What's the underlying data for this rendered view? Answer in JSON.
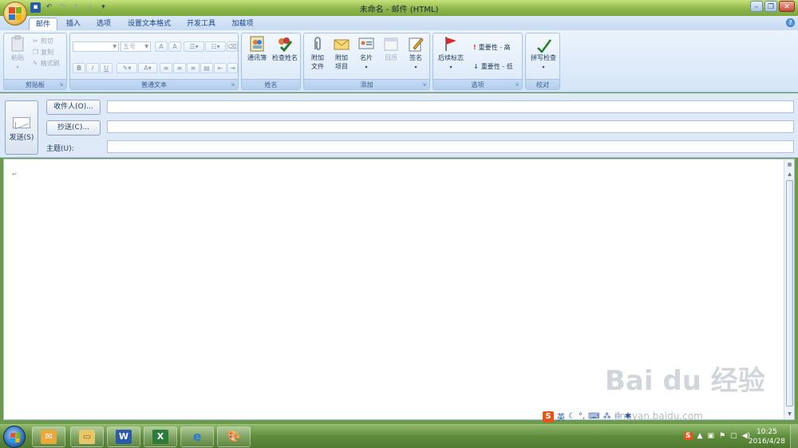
{
  "window": {
    "title": "未命名 - 邮件 (HTML)"
  },
  "qat": [
    "save-icon",
    "undo-icon",
    "redo-icon",
    "up-arrow-icon",
    "down-arrow-icon",
    "customize-icon"
  ],
  "tabs": [
    {
      "label": "邮件",
      "active": true
    },
    {
      "label": "插入"
    },
    {
      "label": "选项"
    },
    {
      "label": "设置文本格式"
    },
    {
      "label": "开发工具"
    },
    {
      "label": "加载项"
    }
  ],
  "groups": {
    "clipboard": {
      "label": "剪贴板",
      "paste": "粘贴",
      "cut": "剪切",
      "copy": "复制",
      "format_painter": "格式刷"
    },
    "basic_text": {
      "label": "普通文本",
      "font_size": "五号",
      "bold": "B",
      "italic": "I",
      "underline": "U",
      "grow": "A",
      "shrink": "A",
      "font_color": "A"
    },
    "names": {
      "label": "姓名",
      "address_book": "通讯簿",
      "check_names": "检查姓名"
    },
    "include": {
      "label": "添加",
      "attach_file_1": "附加",
      "attach_file_2": "文件",
      "attach_item_1": "附加",
      "attach_item_2": "项目",
      "business_card": "名片",
      "calendar": "日历",
      "signature": "签名"
    },
    "options": {
      "label": "选项",
      "follow_up": "后续标志",
      "importance_high": "重要性 - 高",
      "importance_low": "重要性 - 低"
    },
    "proofing": {
      "label": "校对",
      "spelling": "拼写检查",
      "icon_char": "字A"
    }
  },
  "header": {
    "send": "发送(S)",
    "to_button": "收件人(O)...",
    "cc_button": "抄送(C)...",
    "subject_label": "主题(U):",
    "to_value": "",
    "cc_value": "",
    "subject_value": ""
  },
  "body": {
    "paragraph_mark": "↵"
  },
  "ime": {
    "mode": "英",
    "logo": "S"
  },
  "watermark": {
    "brand": "Bai du 经验",
    "url": "jingyan.baidu.com"
  },
  "taskbar": {
    "apps": [
      "outlook",
      "explorer",
      "word",
      "excel",
      "internet-explorer",
      "paint"
    ],
    "clock_time": "10:25",
    "clock_date": "2016/4/28",
    "tray_logo": "S"
  }
}
